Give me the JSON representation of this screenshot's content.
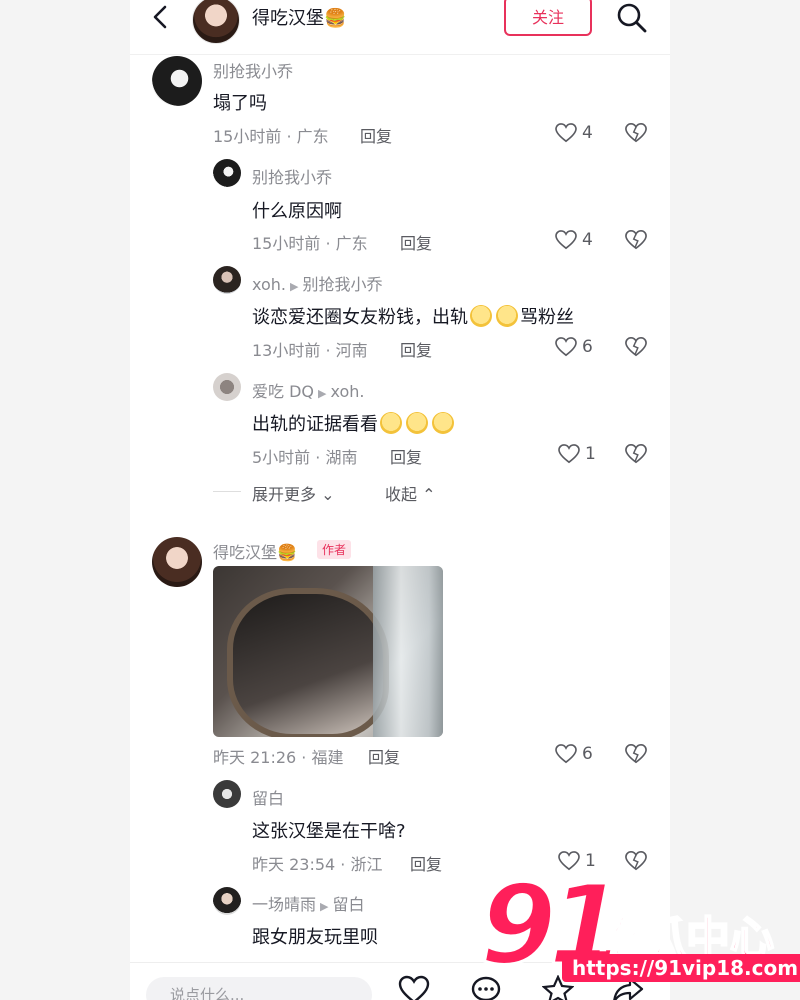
{
  "header": {
    "title": "得吃汉堡🍔",
    "follow_label": "关注"
  },
  "comments": [
    {
      "user": "别抢我小乔",
      "text": "塌了吗",
      "time": "15小时前 · 广东",
      "reply": "回复",
      "likes": "4"
    },
    {
      "user": "别抢我小乔",
      "text": "什么原因啊",
      "time": "15小时前 · 广东",
      "reply": "回复",
      "likes": "4"
    },
    {
      "user": "xoh.",
      "reply_to": "别抢我小乔",
      "text": "谈恋爱还圈女友粉钱，出轨",
      "text_after": "骂粉丝",
      "time": "13小时前 · 河南",
      "reply": "回复",
      "likes": "6"
    },
    {
      "user": "爱吃 DQ",
      "reply_to": "xoh.",
      "text": "出轨的证据看看",
      "time": "5小时前 · 湖南",
      "reply": "回复",
      "likes": "1"
    },
    {
      "user": "得吃汉堡🍔",
      "badge": "作者",
      "time": "昨天 21:26 · 福建",
      "reply": "回复",
      "likes": "6"
    },
    {
      "user": "留白",
      "text": "这张汉堡是在干啥?",
      "time": "昨天 23:54 · 浙江",
      "reply": "回复",
      "likes": "1"
    },
    {
      "user": "一场晴雨",
      "reply_to": "留白",
      "text": "跟女朋友玩里呗"
    }
  ],
  "thread": {
    "expand_more": "展开更多",
    "collapse": "收起"
  },
  "bottom": {
    "input_placeholder": "说点什么..."
  },
  "watermark": {
    "number": "91",
    "text": "吃瓜中心",
    "url": "https://91vip18.com"
  },
  "colors": {
    "accent": "#e8315b",
    "watermark": "#ff1f5a"
  }
}
